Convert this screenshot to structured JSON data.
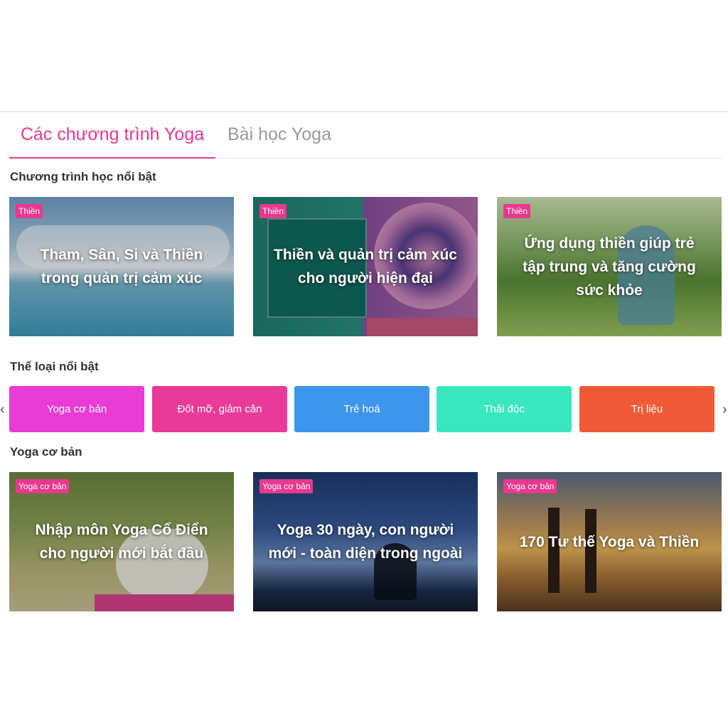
{
  "tabs": [
    {
      "label": "Các chương trình Yoga"
    },
    {
      "label": "Bài học Yoga"
    }
  ],
  "sections": {
    "featured_programs": "Chương trình học nổi bật",
    "featured_categories": "Thể loại nổi bật",
    "basic_yoga": "Yoga cơ bản"
  },
  "featured_cards": [
    {
      "badge": "Thiền",
      "title": "Tham, Sân, Si và Thiền trong quản trị cảm xúc"
    },
    {
      "badge": "Thiền",
      "title": "Thiền và quản trị cảm xúc cho người hiện đại"
    },
    {
      "badge": "Thiền",
      "title": "Ứng dụng thiền giúp trẻ tập trung và tăng cường sức khỏe"
    }
  ],
  "categories": [
    {
      "label": "Yoga cơ bản",
      "color": "#e93bd6"
    },
    {
      "label": "Đốt mỡ, giảm cân",
      "color": "#e93a97"
    },
    {
      "label": "Trẻ hoá",
      "color": "#3d96ea"
    },
    {
      "label": "Thải độc",
      "color": "#3ae6be"
    },
    {
      "label": "Trị liệu",
      "color": "#ee5a37"
    }
  ],
  "nav": {
    "prev": "‹",
    "next": "›"
  },
  "basic_cards": [
    {
      "badge": "Yoga cơ bản",
      "title": "Nhập môn Yoga Cổ Điển cho người mới bắt đầu"
    },
    {
      "badge": "Yoga cơ bản",
      "title": "Yoga 30 ngày, con người mới - toàn diện trong ngoài"
    },
    {
      "badge": "Yoga cơ bản",
      "title": "170 Tư thế Yoga và Thiền"
    }
  ],
  "colors": {
    "accent": "#e8388f"
  }
}
